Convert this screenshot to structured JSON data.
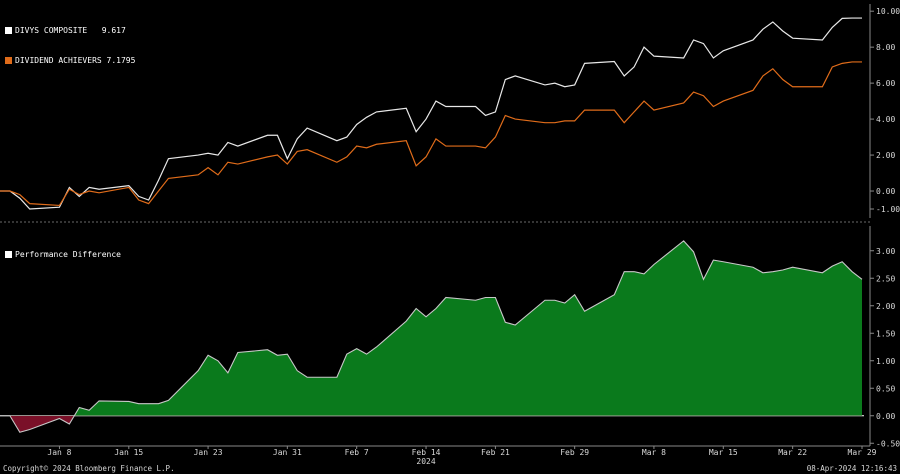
{
  "footer": {
    "copyright": "Copyright© 2024 Bloomberg Finance L.P.",
    "timestamp": "08-Apr-2024 12:16:43"
  },
  "chart_data": [
    {
      "type": "line",
      "x": [
        "2024-01-02",
        "2024-01-03",
        "2024-01-04",
        "2024-01-05",
        "2024-01-08",
        "2024-01-09",
        "2024-01-10",
        "2024-01-11",
        "2024-01-12",
        "2024-01-15",
        "2024-01-16",
        "2024-01-17",
        "2024-01-18",
        "2024-01-19",
        "2024-01-22",
        "2024-01-23",
        "2024-01-24",
        "2024-01-25",
        "2024-01-26",
        "2024-01-29",
        "2024-01-30",
        "2024-01-31",
        "2024-02-01",
        "2024-02-02",
        "2024-02-05",
        "2024-02-06",
        "2024-02-07",
        "2024-02-08",
        "2024-02-09",
        "2024-02-12",
        "2024-02-13",
        "2024-02-14",
        "2024-02-15",
        "2024-02-16",
        "2024-02-19",
        "2024-02-20",
        "2024-02-21",
        "2024-02-22",
        "2024-02-23",
        "2024-02-26",
        "2024-02-27",
        "2024-02-28",
        "2024-02-29",
        "2024-03-01",
        "2024-03-04",
        "2024-03-05",
        "2024-03-06",
        "2024-03-07",
        "2024-03-08",
        "2024-03-11",
        "2024-03-12",
        "2024-03-13",
        "2024-03-14",
        "2024-03-15",
        "2024-03-18",
        "2024-03-19",
        "2024-03-20",
        "2024-03-21",
        "2024-03-22",
        "2024-03-25",
        "2024-03-26",
        "2024-03-27",
        "2024-03-28",
        "2024-03-29"
      ],
      "series": [
        {
          "name": "DIVYS COMPOSITE",
          "last": "9.617",
          "color": "#e8e8e8",
          "values": [
            0.0,
            0.0,
            -0.4,
            -1.0,
            -0.9,
            0.2,
            -0.3,
            0.2,
            0.1,
            0.3,
            -0.3,
            -0.5,
            0.6,
            1.8,
            2.0,
            2.1,
            2.0,
            2.7,
            2.5,
            3.1,
            3.1,
            1.8,
            2.9,
            3.5,
            2.8,
            3.0,
            3.7,
            4.1,
            4.4,
            4.6,
            3.3,
            4.0,
            5.0,
            4.7,
            4.7,
            4.2,
            4.4,
            6.2,
            6.4,
            5.9,
            6.0,
            5.8,
            5.9,
            7.1,
            7.2,
            6.4,
            6.9,
            8.0,
            7.5,
            7.4,
            8.4,
            8.2,
            7.4,
            7.8,
            8.4,
            9.0,
            9.4,
            8.9,
            8.5,
            8.4,
            9.1,
            9.6,
            9.617,
            9.617
          ]
        },
        {
          "name": "DIVIDEND ACHIEVERS",
          "last": "7.1795",
          "color": "#e06c1a",
          "values": [
            0.0,
            0.0,
            -0.2,
            -0.7,
            -0.8,
            0.1,
            -0.2,
            0.0,
            -0.1,
            0.2,
            -0.5,
            -0.7,
            0.0,
            0.7,
            0.9,
            1.3,
            0.9,
            1.6,
            1.5,
            1.9,
            2.0,
            1.5,
            2.2,
            2.3,
            1.6,
            1.9,
            2.5,
            2.4,
            2.6,
            2.8,
            1.4,
            1.9,
            2.9,
            2.5,
            2.5,
            2.4,
            3.0,
            4.2,
            4.0,
            3.8,
            3.8,
            3.9,
            3.9,
            4.5,
            4.5,
            3.8,
            4.4,
            5.0,
            4.5,
            4.9,
            5.5,
            5.3,
            4.7,
            5.0,
            5.6,
            6.4,
            6.8,
            6.2,
            5.8,
            5.8,
            6.9,
            7.1,
            7.1795,
            7.1795
          ]
        }
      ],
      "ylim": [
        -1.5,
        10.4
      ],
      "yticks": [
        "-1.00",
        "0.00",
        "2.00",
        "4.00",
        "6.00",
        "8.00",
        "10.00"
      ],
      "grid": false,
      "legend_position": "top-left"
    },
    {
      "type": "area",
      "x": [
        "2024-01-02",
        "2024-01-03",
        "2024-01-04",
        "2024-01-05",
        "2024-01-08",
        "2024-01-09",
        "2024-01-10",
        "2024-01-11",
        "2024-01-12",
        "2024-01-15",
        "2024-01-16",
        "2024-01-17",
        "2024-01-18",
        "2024-01-19",
        "2024-01-22",
        "2024-01-23",
        "2024-01-24",
        "2024-01-25",
        "2024-01-26",
        "2024-01-29",
        "2024-01-30",
        "2024-01-31",
        "2024-02-01",
        "2024-02-02",
        "2024-02-05",
        "2024-02-06",
        "2024-02-07",
        "2024-02-08",
        "2024-02-09",
        "2024-02-12",
        "2024-02-13",
        "2024-02-14",
        "2024-02-15",
        "2024-02-16",
        "2024-02-19",
        "2024-02-20",
        "2024-02-21",
        "2024-02-22",
        "2024-02-23",
        "2024-02-26",
        "2024-02-27",
        "2024-02-28",
        "2024-02-29",
        "2024-03-01",
        "2024-03-04",
        "2024-03-05",
        "2024-03-06",
        "2024-03-07",
        "2024-03-08",
        "2024-03-11",
        "2024-03-12",
        "2024-03-13",
        "2024-03-14",
        "2024-03-15",
        "2024-03-18",
        "2024-03-19",
        "2024-03-20",
        "2024-03-21",
        "2024-03-22",
        "2024-03-25",
        "2024-03-26",
        "2024-03-27",
        "2024-03-28",
        "2024-03-29"
      ],
      "series": [
        {
          "name": "Performance Difference",
          "color": "#ffffff",
          "positive_fill": "#0a7a1c",
          "negative_fill": "#7a1028",
          "values": [
            0.0,
            0.0,
            -0.3,
            -0.25,
            -0.05,
            -0.15,
            0.15,
            0.1,
            0.27,
            0.26,
            0.22,
            0.22,
            0.22,
            0.28,
            0.82,
            1.1,
            1.0,
            0.78,
            1.15,
            1.2,
            1.1,
            1.12,
            0.82,
            0.7,
            0.7,
            1.12,
            1.22,
            1.12,
            1.25,
            1.72,
            1.95,
            1.8,
            1.95,
            2.15,
            2.1,
            2.15,
            2.15,
            1.7,
            1.65,
            2.1,
            2.1,
            2.05,
            2.2,
            1.9,
            2.2,
            2.62,
            2.62,
            2.58,
            2.75,
            3.18,
            2.98,
            2.48,
            2.83,
            2.8,
            2.7,
            2.6,
            2.62,
            2.65,
            2.7,
            2.6,
            2.72,
            2.8,
            2.62,
            2.48
          ]
        }
      ],
      "ylim": [
        -0.55,
        3.45
      ],
      "yticks": [
        "-0.50",
        "0.00",
        "0.50",
        "1.00",
        "1.50",
        "2.00",
        "2.50",
        "3.00"
      ],
      "grid": false,
      "legend_position": "top-left"
    }
  ],
  "xaxis": {
    "tick_dates": [
      "2024-01-08",
      "2024-01-15",
      "2024-01-23",
      "2024-01-31",
      "2024-02-07",
      "2024-02-14",
      "2024-02-21",
      "2024-02-29",
      "2024-03-08",
      "2024-03-15",
      "2024-03-22",
      "2024-03-29"
    ],
    "tick_labels": [
      "Jan 8",
      "Jan 15",
      "Jan 23",
      "Jan 31",
      "Feb 7",
      "Feb 14",
      "Feb 21",
      "Feb 29",
      "Mar 8",
      "Mar 15",
      "Mar 22",
      "Mar 29"
    ],
    "year_label": "2024"
  }
}
